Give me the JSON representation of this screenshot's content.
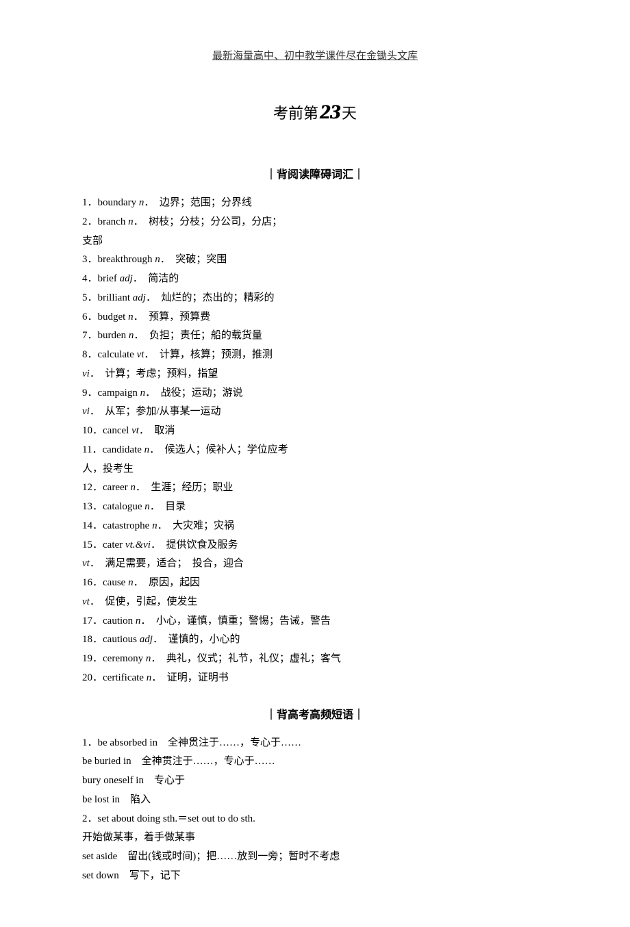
{
  "header": {
    "text": "最新海量高中、初中教学课件尽在金锄头文库"
  },
  "title": {
    "prefix": "考前第",
    "number": "23",
    "suffix": "天"
  },
  "sections": [
    {
      "heading": "｜背阅读障碍词汇｜",
      "items": [
        {
          "num": "1．",
          "word": "boundary ",
          "pos": "n",
          "def": "．　边界；范围；分界线"
        },
        {
          "num": "2．",
          "word": "branch ",
          "pos": "n",
          "def": "．　树枝；分枝；分公司，分店；"
        },
        {
          "num": "",
          "word": "",
          "pos": "",
          "def": "支部"
        },
        {
          "num": "3．",
          "word": "breakthrough ",
          "pos": "n",
          "def": "．　突破；突围"
        },
        {
          "num": "4．",
          "word": "brief ",
          "pos": "adj",
          "def": "．　简洁的"
        },
        {
          "num": "5．",
          "word": "brilliant ",
          "pos": "adj",
          "def": "．　灿烂的；杰出的；精彩的"
        },
        {
          "num": "6．",
          "word": "budget ",
          "pos": "n",
          "def": "．　预算，预算费"
        },
        {
          "num": "7．",
          "word": "burden ",
          "pos": "n",
          "def": "．　负担；责任；船的载货量"
        },
        {
          "num": "8．",
          "word": "calculate ",
          "pos": "vt",
          "def": "．　计算，核算；预测，推测"
        },
        {
          "num": "",
          "word": "",
          "pos": "vi",
          "def": "．　计算；考虑；预料，指望"
        },
        {
          "num": "9．",
          "word": "campaign ",
          "pos": "n",
          "def": "．　战役；运动；游说"
        },
        {
          "num": "",
          "word": "",
          "pos": "vi",
          "def": "．　从军；参加/从事某一运动"
        },
        {
          "num": "10．",
          "word": "cancel ",
          "pos": "vt",
          "def": "．　取消"
        },
        {
          "num": "11．",
          "word": "candidate ",
          "pos": "n",
          "def": "．　候选人；候补人；学位应考"
        },
        {
          "num": "",
          "word": "",
          "pos": "",
          "def": "人，投考生"
        },
        {
          "num": "12．",
          "word": "career ",
          "pos": "n",
          "def": "．　生涯；经历；职业"
        },
        {
          "num": "13．",
          "word": "catalogue ",
          "pos": "n",
          "def": "．　目录"
        },
        {
          "num": "14．",
          "word": "catastrophe ",
          "pos": "n",
          "def": "．　大灾难；灾祸"
        },
        {
          "num": "15．",
          "word": "cater ",
          "pos": "vt.&vi",
          "def": "．　提供饮食及服务"
        },
        {
          "num": "",
          "word": "",
          "pos": "vt",
          "def": "．　满足需要，适合；　投合，迎合"
        },
        {
          "num": "16．",
          "word": "cause ",
          "pos": "n",
          "def": "．　原因，起因"
        },
        {
          "num": "",
          "word": "",
          "pos": "vt",
          "def": "．　促使，引起，使发生"
        },
        {
          "num": "17．",
          "word": "caution ",
          "pos": "n",
          "def": "．　小心，谨慎，慎重；警惕；告诫，警告"
        },
        {
          "num": "18．",
          "word": "cautious ",
          "pos": "adj",
          "def": "．　谨慎的，小心的"
        },
        {
          "num": "19．",
          "word": "ceremony ",
          "pos": "n",
          "def": "．　典礼，仪式；礼节，礼仪；虚礼；客气"
        },
        {
          "num": "20．",
          "word": "certificate ",
          "pos": "n",
          "def": "．　证明，证明书"
        }
      ]
    },
    {
      "heading": "｜背高考高频短语｜",
      "items": [
        {
          "num": "1．",
          "word": "be absorbed in",
          "pos": "",
          "def": "　全神贯注于……，专心于……"
        },
        {
          "num": "",
          "word": "be buried in",
          "pos": "",
          "def": "　全神贯注于……，专心于……"
        },
        {
          "num": "",
          "word": "bury oneself in",
          "pos": "",
          "def": "　专心于"
        },
        {
          "num": "",
          "word": "be lost in",
          "pos": "",
          "def": "　陷入"
        },
        {
          "num": "2．",
          "word": "set about doing sth.＝set out to do sth.",
          "pos": "",
          "def": ""
        },
        {
          "num": "",
          "word": "",
          "pos": "",
          "def": "开始做某事，着手做某事"
        },
        {
          "num": "",
          "word": "set aside",
          "pos": "",
          "def": "　留出(钱或时间)；把……放到一旁；暂时不考虑"
        },
        {
          "num": "",
          "word": "set down",
          "pos": "",
          "def": "　写下，记下"
        }
      ]
    }
  ]
}
